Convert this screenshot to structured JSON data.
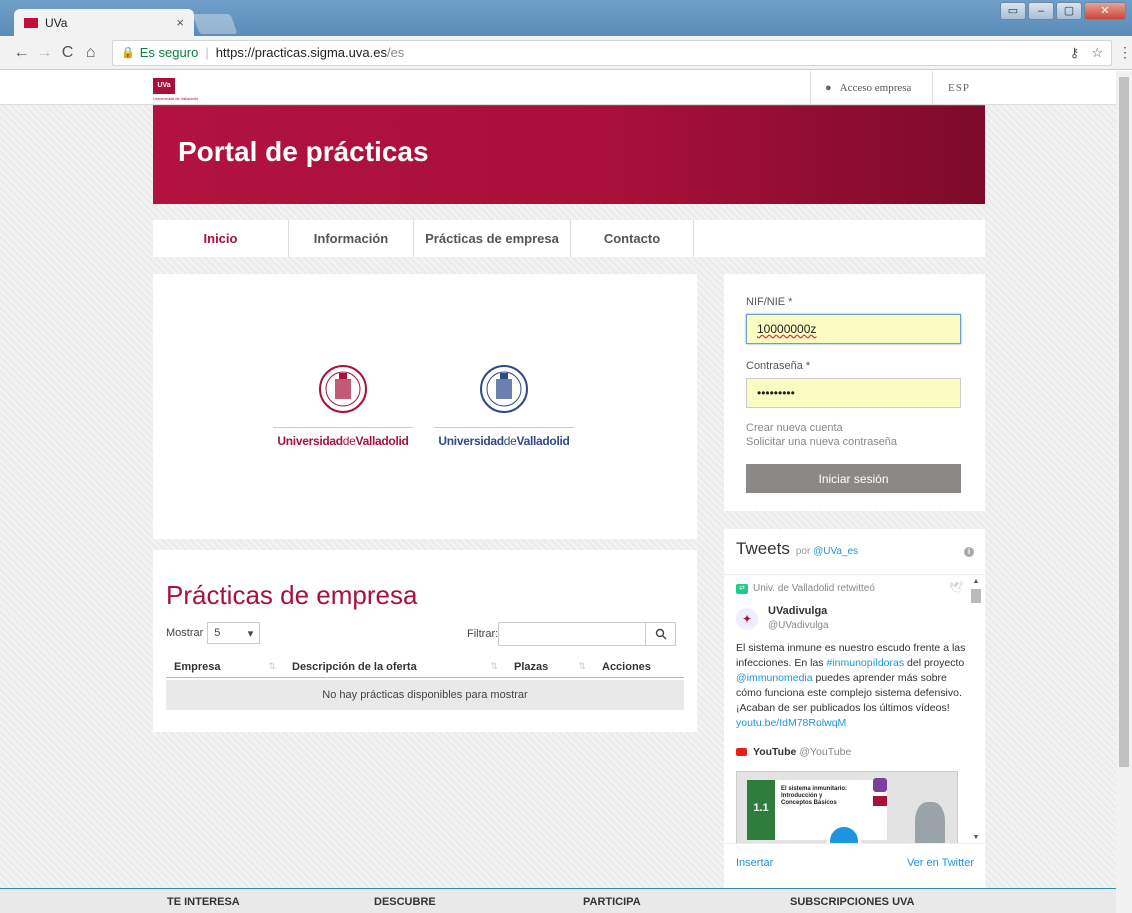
{
  "browser": {
    "tab_title": "UVa",
    "tab_close": "×",
    "secure_label": "Es seguro",
    "url_host": "https://practicas.sigma.uva.es",
    "url_path": "/es",
    "window_controls": [
      "▭",
      "–",
      "▢",
      "✕"
    ]
  },
  "topbar": {
    "logo_text": "UVa",
    "logo_sub": "Universidad de Valladolid",
    "access_label": "Acceso empresa",
    "lang_label": "ESP"
  },
  "banner": {
    "title": "Portal de prácticas"
  },
  "nav": {
    "items": [
      {
        "label": "Inicio",
        "active": true
      },
      {
        "label": "Información"
      },
      {
        "label": "Prácticas de empresa"
      },
      {
        "label": "Contacto"
      }
    ]
  },
  "logos": {
    "left": {
      "name_a": "Universidad",
      "name_b": "de",
      "name_c": "Valladolid",
      "color": "#a8123a"
    },
    "right": {
      "name_a": "Universidad",
      "name_b": "de",
      "name_c": "Valladolid",
      "color": "#2e4a8a"
    }
  },
  "practicas": {
    "title": "Prácticas de empresa",
    "mostrar_label": "Mostrar",
    "mostrar_value": "5",
    "filtrar_label": "Filtrar:",
    "filtrar_value": "",
    "columns": [
      "Empresa",
      "Descripción de la oferta",
      "Plazas",
      "Acciones"
    ],
    "empty_message": "No hay prácticas disponibles para mostrar"
  },
  "login": {
    "nif_label": "NIF/NIE *",
    "nif_value": "10000000z",
    "password_label": "Contraseña *",
    "password_value": "•••••••••",
    "create_account": "Crear nueva cuenta",
    "request_password": "Solicitar una nueva contraseña",
    "submit_label": "Iniciar sesión"
  },
  "tweets": {
    "title": "Tweets",
    "by_prefix": "por",
    "by_handle": "@UVa_es",
    "retweet_label": "Univ. de Valladolid retwitteó",
    "author_name": "UVadivulga",
    "author_handle": "@UVadivulga",
    "text_1": "El sistema inmune es nuestro escudo frente a las infecciones. En las ",
    "link_1": "#inmunopíldoras",
    "text_2": " del proyecto ",
    "link_2": "@immunomedia",
    "text_3": " puedes aprender más sobre cómo funciona este complejo sistema defensivo. ¡Acaban de ser publicados los últimos vídeos! ",
    "link_3": "youtu.be/IdM78RolwqM",
    "yt_name": "YouTube",
    "yt_handle": "@YouTube",
    "video_number": "1.1",
    "video_title": "El sistema inmunitario: Introducción y Conceptos Básicos",
    "insert_label": "Insertar",
    "view_label": "Ver en Twitter"
  },
  "footer": {
    "items": [
      "TE INTERESA",
      "DESCUBRE",
      "PARTICIPA",
      "SUBSCRIPCIONES UVA"
    ]
  }
}
